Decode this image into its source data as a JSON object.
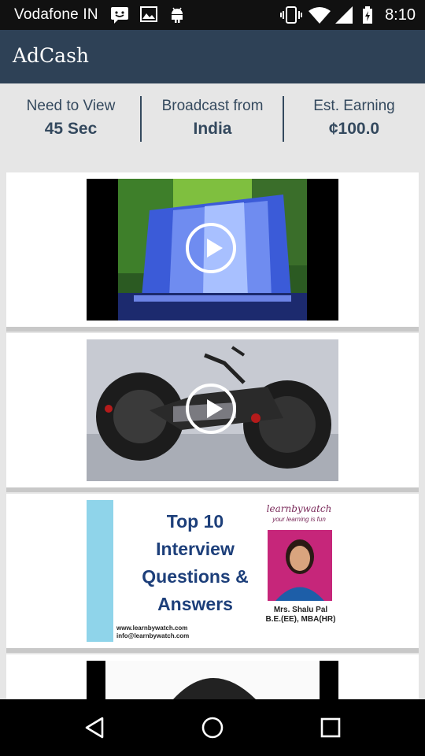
{
  "status_bar": {
    "carrier": "Vodafone IN",
    "time": "8:10",
    "left_icons": [
      "message-icon",
      "image-icon",
      "android-icon"
    ],
    "right_icons": [
      "vibrate-icon",
      "wifi-icon",
      "signal-icon",
      "battery-icon"
    ]
  },
  "app_bar": {
    "title": "AdCash",
    "color": "#2e4156"
  },
  "stats": [
    {
      "label": "Need to View",
      "value": "45 Sec"
    },
    {
      "label": "Broadcast from",
      "value": "India"
    },
    {
      "label": "Est. Earning",
      "value": "¢100.0"
    }
  ],
  "videos": [
    {
      "thumbnail": "waterfall",
      "playable": true
    },
    {
      "thumbnail": "motorcycle",
      "playable": true
    },
    {
      "thumbnail": "interview",
      "playable": false,
      "heading": "Top 10 Interview Questions & Answers",
      "brand": "learnbywatch",
      "tagline": "your learning is fun",
      "presenter_name": "Mrs. Shalu Pal",
      "presenter_credentials": "B.E.(EE), MBA(HR)",
      "website": "www.learnbywatch.com",
      "email": "info@learnbywatch.com"
    },
    {
      "thumbnail": "portrait",
      "playable": false
    }
  ],
  "nav_bar": {
    "buttons": [
      "back-icon",
      "home-icon",
      "recents-icon"
    ]
  }
}
